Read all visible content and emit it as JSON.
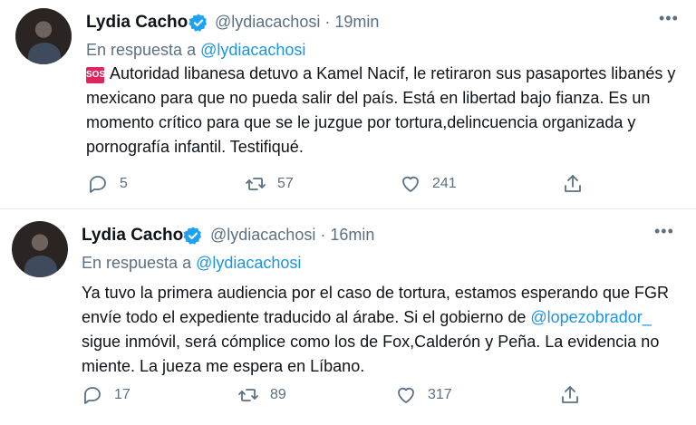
{
  "colors": {
    "accent": "#1b95e0",
    "muted": "#5b7083",
    "verified": "#1da1f2",
    "sos": "#e0245e"
  },
  "tweets": [
    {
      "name": "Lydia Cacho",
      "handle_time": "@lydiacachosi · 19min",
      "reply_prefix": "En respuesta a",
      "reply_to": "@lydiacachosi",
      "emoji": "SOS",
      "text": "Autoridad libanesa detuvo a Kamel Nacif, le retiraron sus pasaportes libanés y mexicano para que no pueda salir del país. Está en libertad bajo fianza. Es un momento crítico para que se le juzgue por tortura,delincuencia organizada y pornografía  infantil. Testifiqué.",
      "replies": "5",
      "retweets": "57",
      "likes": "241"
    },
    {
      "name": "Lydia Cacho",
      "handle_time": "@lydiacachosi · 16min",
      "reply_prefix": "En respuesta a",
      "reply_to": "@lydiacachosi",
      "text_1": "Ya tuvo la primera audiencia por el caso de tortura, estamos esperando que FGR envíe todo el expediente traducido al árabe. Si el gobierno de",
      "mention": "@lopezobrador_",
      "text_2": "  sigue inmóvil, será cómplice como los de Fox,Calderón y Peña. La evidencia no miente. La jueza me espera en Líbano.",
      "replies": "17",
      "retweets": "89",
      "likes": "317"
    }
  ],
  "icons": [
    "verified-badge-icon",
    "more-icon",
    "reply-icon",
    "retweet-icon",
    "like-icon",
    "share-icon"
  ]
}
